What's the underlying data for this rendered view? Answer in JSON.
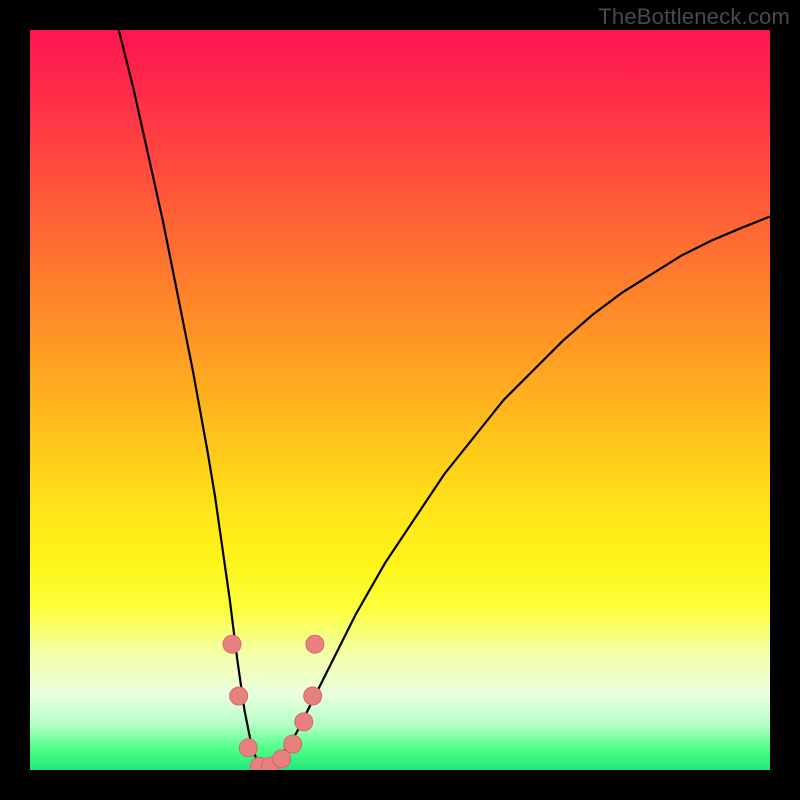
{
  "watermark": {
    "text": "TheBottleneck.com"
  },
  "colors": {
    "frame": "#000000",
    "curve": "#000000",
    "marker_fill": "#e88080",
    "marker_stroke": "#d46a6a"
  },
  "chart_data": {
    "type": "line",
    "title": "",
    "xlabel": "",
    "ylabel": "",
    "xlim": [
      0,
      100
    ],
    "ylim": [
      0,
      100
    ],
    "grid": false,
    "legend": null,
    "series": [
      {
        "name": "bottleneck-curve",
        "x": [
          12,
          14,
          16,
          18,
          20,
          22,
          24,
          25,
          26,
          27,
          28,
          29,
          30,
          31,
          32,
          33,
          34,
          36,
          38,
          40,
          44,
          48,
          52,
          56,
          60,
          64,
          68,
          72,
          76,
          80,
          84,
          88,
          92,
          96,
          100
        ],
        "y": [
          100,
          92,
          83,
          74,
          64,
          54,
          43,
          37,
          30,
          23,
          15,
          8,
          3,
          0.5,
          0,
          0.5,
          2,
          5,
          9,
          13,
          21,
          28,
          34,
          40,
          45,
          50,
          54,
          58,
          61.5,
          64.5,
          67,
          69.5,
          71.5,
          73.2,
          74.8
        ]
      }
    ],
    "markers": {
      "name": "highlight-points",
      "points": [
        {
          "x": 27.3,
          "y": 17
        },
        {
          "x": 28.2,
          "y": 10
        },
        {
          "x": 29.5,
          "y": 3
        },
        {
          "x": 31.0,
          "y": 0.5
        },
        {
          "x": 32.5,
          "y": 0.5
        },
        {
          "x": 34.0,
          "y": 1.5
        },
        {
          "x": 35.5,
          "y": 3.5
        },
        {
          "x": 37.0,
          "y": 6.5
        },
        {
          "x": 38.2,
          "y": 10
        },
        {
          "x": 38.5,
          "y": 17
        }
      ]
    },
    "background_gradient_stops": [
      {
        "pos": 0,
        "color": "#ff1450"
      },
      {
        "pos": 50,
        "color": "#ffcd1a"
      },
      {
        "pos": 80,
        "color": "#fdff3a"
      },
      {
        "pos": 100,
        "color": "#20e878"
      }
    ]
  }
}
